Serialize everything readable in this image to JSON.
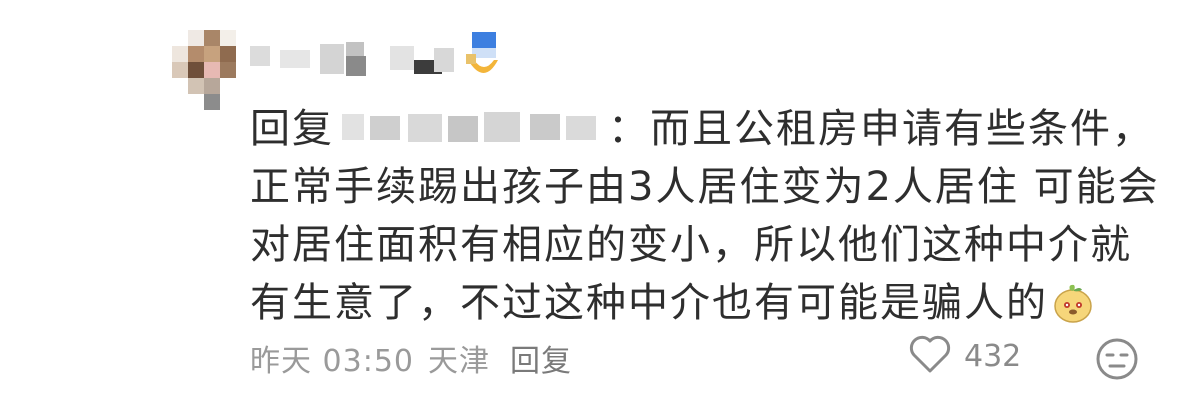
{
  "comment": {
    "author_name": "",
    "reply_prefix": "回复",
    "reply_target": "",
    "colon": "：",
    "text_line1": "而且公租房申请有些条件，",
    "text_line2": "正常手续踢出孩子由3人居住变为2人居住 可能会",
    "text_line3": "对居住面积有相应的变小，所以他们这种中介就",
    "text_line4": "有生意了，不过这种中介也有可能是骗人的",
    "emoji_name": "doge-peach-emoji",
    "meta": {
      "time": "昨天 03:50",
      "location": "天津",
      "reply_button": "回复"
    },
    "likes": "432",
    "icons": {
      "like": "heart-outline-icon",
      "dislike": "meh-face-icon",
      "badge": "blue-badge-icon"
    },
    "colors": {
      "text": "#2e2e2e",
      "meta": "#9a9a9a",
      "icon": "#8a8a8a"
    }
  }
}
